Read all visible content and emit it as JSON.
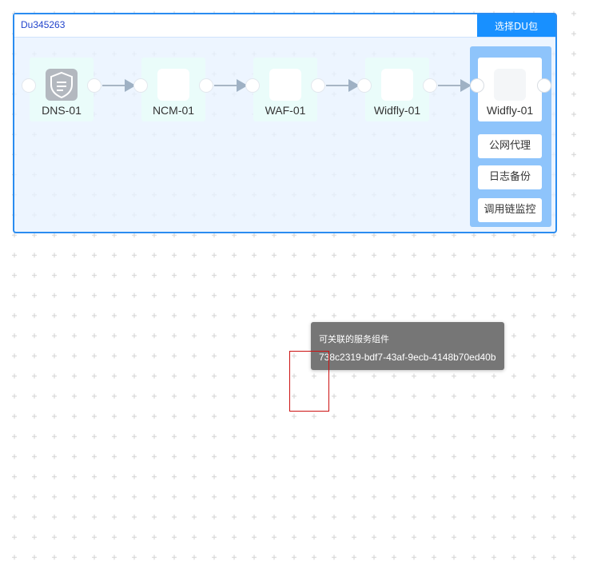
{
  "du_panel": {
    "id": "Du345263",
    "select_button": "选择DU包",
    "accent_color": "#1890ff",
    "border_color": "#2a8cf0"
  },
  "nodes": [
    {
      "label": "DNS-01",
      "icon": "shield-doc-icon"
    },
    {
      "label": "NCM-01",
      "icon": "blank-icon"
    },
    {
      "label": "WAF-01",
      "icon": "blank-icon"
    },
    {
      "label": "Widfly-01",
      "icon": "blank-icon"
    }
  ],
  "group": {
    "node_label": "Widfly-01",
    "chips": [
      "公网代理",
      "日志备份",
      "调用链监控"
    ]
  },
  "tooltip": {
    "title": "可关联的服务组件",
    "value": "738c2319-bdf7-43af-9ecb-4148b70ed40b"
  }
}
